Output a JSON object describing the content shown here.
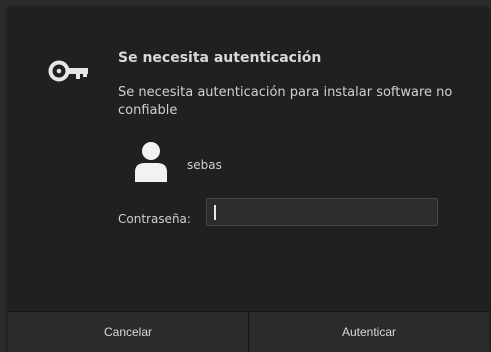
{
  "dialog": {
    "title": "Se necesita autenticación",
    "description": "Se necesita autenticación para instalar software no confiable",
    "icon": "key-icon"
  },
  "user": {
    "name": "sebas",
    "icon": "avatar-icon"
  },
  "password": {
    "label": "Contraseña:",
    "value": ""
  },
  "buttons": {
    "cancel": "Cancelar",
    "authenticate": "Autenticar"
  },
  "colors": {
    "background": "#202020",
    "button_bar": "#2b2b2b",
    "text": "#d8d8d8"
  }
}
